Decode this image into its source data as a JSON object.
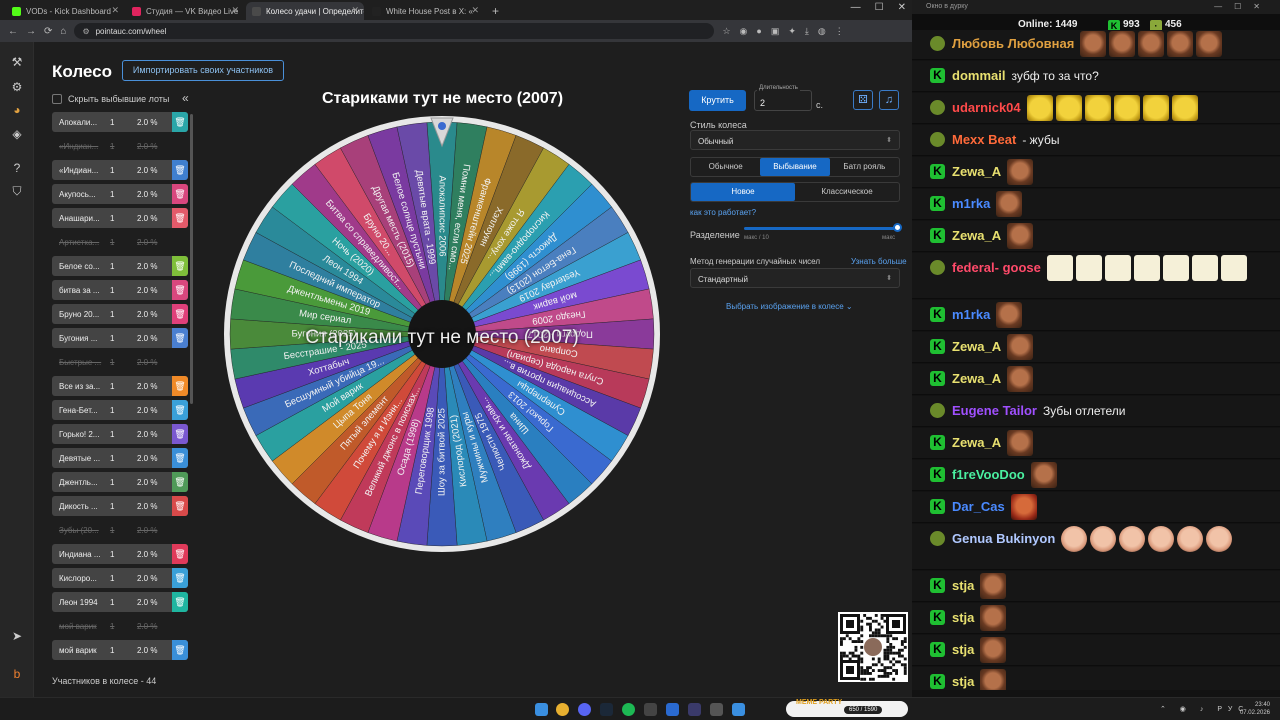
{
  "browser": {
    "tabs": [
      {
        "label": "VODs - Kick Dashboard",
        "color": "#53fc18",
        "active": false
      },
      {
        "label": "Студия — VK Видео Live",
        "color": "#e0245e",
        "active": false
      },
      {
        "label": "Колесо удачи | Определите ви",
        "color": "#4a4a4a",
        "active": true
      },
      {
        "label": "White House Post в X: «",
        "color": "#222222",
        "active": false
      }
    ],
    "url": "pointauc.com/wheel"
  },
  "page": {
    "title": "Колесо",
    "import_button": "Импортировать своих участников",
    "hide_dropped": "Скрыть выбывшие лоты",
    "participants_count": "Участников в колесе - 44",
    "lots": [
      {
        "name": "Апокали...",
        "qty": "1",
        "pct": "2.0 %",
        "color": "#2aa6a8",
        "out": false
      },
      {
        "name": "«Индиан...",
        "qty": "1",
        "pct": "2.0 %",
        "color": "#666666",
        "out": true
      },
      {
        "name": "«Индиан...",
        "qty": "1",
        "pct": "2.0 %",
        "color": "#3f7fcf",
        "out": false
      },
      {
        "name": "Акупось...",
        "qty": "1",
        "pct": "2.0 %",
        "color": "#d9477e",
        "out": false
      },
      {
        "name": "Анашари...",
        "qty": "1",
        "pct": "2.0 %",
        "color": "#e35a6a",
        "out": false
      },
      {
        "name": "Артистка...",
        "qty": "1",
        "pct": "2.0 %",
        "color": "#666666",
        "out": true
      },
      {
        "name": "Белое со...",
        "qty": "1",
        "pct": "2.0 %",
        "color": "#7fbf3a",
        "out": false
      },
      {
        "name": "битва за ...",
        "qty": "1",
        "pct": "2.0 %",
        "color": "#d9477e",
        "out": false
      },
      {
        "name": "Бруно 20...",
        "qty": "1",
        "pct": "2.0 %",
        "color": "#e0407a",
        "out": false
      },
      {
        "name": "Бугония ...",
        "qty": "1",
        "pct": "2.0 %",
        "color": "#4a7fd0",
        "out": false
      },
      {
        "name": "Быстрые ...",
        "qty": "1",
        "pct": "2.0 %",
        "color": "#666666",
        "out": true
      },
      {
        "name": "Все из за...",
        "qty": "1",
        "pct": "2.0 %",
        "color": "#f08a28",
        "out": false
      },
      {
        "name": "Гена-Бет...",
        "qty": "1",
        "pct": "2.0 %",
        "color": "#3aa0d8",
        "out": false
      },
      {
        "name": "Горько! 2...",
        "qty": "1",
        "pct": "2.0 %",
        "color": "#7a58d0",
        "out": false
      },
      {
        "name": "Девятые ...",
        "qty": "1",
        "pct": "2.0 %",
        "color": "#3a8fd8",
        "out": false
      },
      {
        "name": "Джентль...",
        "qty": "1",
        "pct": "2.0 %",
        "color": "#4f9a58",
        "out": false
      },
      {
        "name": "Дикость ...",
        "qty": "1",
        "pct": "2.0 %",
        "color": "#d84a4a",
        "out": false
      },
      {
        "name": "Зубы (20...",
        "qty": "1",
        "pct": "2.0 %",
        "color": "#666666",
        "out": true
      },
      {
        "name": "Индиана ...",
        "qty": "1",
        "pct": "2.0 %",
        "color": "#e03a5a",
        "out": false
      },
      {
        "name": "Кислоро...",
        "qty": "1",
        "pct": "2.0 %",
        "color": "#3aa0d8",
        "out": false
      },
      {
        "name": "Леон 1994",
        "qty": "1",
        "pct": "2.0 %",
        "color": "#1fb6a0",
        "out": false
      },
      {
        "name": "мой варик",
        "qty": "1",
        "pct": "2.0 %",
        "color": "#666666",
        "out": true
      },
      {
        "name": "мой варик",
        "qty": "1",
        "pct": "2.0 %",
        "color": "#3a8fd8",
        "out": false
      }
    ]
  },
  "wheel": {
    "title": "Стариками тут не место (2007)",
    "center_label": "Стариками тут не место (2007)",
    "sectors": [
      {
        "label": "Апокалипсис 2006",
        "color": "#2a8a8c"
      },
      {
        "label": "Помни меня, если смо...",
        "color": "#2f7f5f"
      },
      {
        "label": "Франкенштейн 2025",
        "color": "#b8862a"
      },
      {
        "label": "Хэллоуин",
        "color": "#8a6a2a"
      },
      {
        "label": "Я тоже хочу...",
        "color": "#a89a30"
      },
      {
        "label": "Кислородно-вамп...",
        "color": "#2b9fb0"
      },
      {
        "label": "Дикость (1998)",
        "color": "#2f8fd0"
      },
      {
        "label": "Гена-Бетон (2013)",
        "color": "#4a7fbf"
      },
      {
        "label": "Yesterday 2019",
        "color": "#3aa0d0"
      },
      {
        "label": "мой варик",
        "color": "#7a4ad0"
      },
      {
        "label": "Гнездо 2009",
        "color": "#c04a8a"
      },
      {
        "label": "Подруги - 2017",
        "color": "#8a3a9a"
      },
      {
        "label": "Сопрано",
        "color": "#c04a50"
      },
      {
        "label": "Слуга народа (сериал)",
        "color": "#b83a5a"
      },
      {
        "label": "Ассоциация против в...",
        "color": "#5a3aa8"
      },
      {
        "label": "Суперперцы",
        "color": "#2f8fd0"
      },
      {
        "label": "Горько! 2013",
        "color": "#3a6ad0"
      },
      {
        "label": "Шина",
        "color": "#2a7fc0"
      },
      {
        "label": "Джонатан и храм...",
        "color": "#6a3ab0"
      },
      {
        "label": "Челюсти 1975",
        "color": "#3a5ab8"
      },
      {
        "label": "Мужчины и куры",
        "color": "#2f7fbf"
      },
      {
        "label": "Кислород (2021)",
        "color": "#2a8ab8"
      },
      {
        "label": "Шоу за битвой 2025",
        "color": "#3a5ab8"
      },
      {
        "label": "Переговорщик 1998",
        "color": "#5a4ab8"
      },
      {
        "label": "Осада (1998)",
        "color": "#b83a8a"
      },
      {
        "label": "Великий джонс в поисках...",
        "color": "#c03a5a"
      },
      {
        "label": "Почему я и Иэнн...",
        "color": "#d04a3a"
      },
      {
        "label": "Пятый элемент",
        "color": "#c05a2a"
      },
      {
        "label": "Цыпа Тоня",
        "color": "#d08a2a"
      },
      {
        "label": "Мой варик",
        "color": "#2aa0a0"
      },
      {
        "label": "Бесшумный убийца 19...",
        "color": "#3a6ab8"
      },
      {
        "label": "Хоттабыч",
        "color": "#5a3ab0"
      },
      {
        "label": "Бесстрашие - 2025",
        "color": "#2f8a6a"
      },
      {
        "label": "Бугония (2025)",
        "color": "#4a8a3a"
      },
      {
        "label": "Мир сериал",
        "color": "#3a8a4a"
      },
      {
        "label": "Джентльмены 2019",
        "color": "#4a9a3a"
      },
      {
        "label": "Последний император",
        "color": "#2f7f9f"
      },
      {
        "label": "Леон 1994",
        "color": "#2a8a9a"
      },
      {
        "label": "Ночь (2020)",
        "color": "#2aa0a0"
      },
      {
        "label": "Битва со справедливост...",
        "color": "#a03a8a"
      },
      {
        "label": "Бруно 20...",
        "color": "#d04a6a"
      },
      {
        "label": "Другая месть (2015)",
        "color": "#a8407a"
      },
      {
        "label": "Белое солнце пустыни",
        "color": "#7a3aa0"
      },
      {
        "label": "Девятые врата - 1999",
        "color": "#6a4aa8"
      }
    ]
  },
  "settings": {
    "spin_button": "Крутить",
    "duration_label": "Длительность",
    "duration_value": "2",
    "seconds": "с.",
    "style_label": "Стиль колеса",
    "style_value": "Обычный",
    "modes": [
      "Обычное",
      "Выбывание",
      "Батл рояль"
    ],
    "active_mode": "Выбывание",
    "variants": [
      "Новое",
      "Классическое"
    ],
    "active_variant": "Новое",
    "how_it_works": "как это работает?",
    "split_label": "Разделение",
    "split_min": "макс / 10",
    "split_max": "макс",
    "split_level": 1.0,
    "rng_label": "Метод генерации случайных чисел",
    "learn_more": "Узнать больше",
    "rng_value": "Стандартный",
    "choose_image": "Выбрать изображение в колесе"
  },
  "chat": {
    "window_title": "Окно в дурку",
    "online_label": "Online:",
    "online_value": "1449",
    "kick_value": "993",
    "other_value": "456",
    "messages": [
      {
        "user": "Любовь Любовная",
        "color": "#e0a040",
        "badge": "pepe",
        "text": "",
        "emotes": [
          "face",
          "face",
          "face",
          "face",
          "face"
        ]
      },
      {
        "user": "dommail",
        "color": "#e8e070",
        "badge": "kick",
        "text": "зубф то за что?",
        "emotes": []
      },
      {
        "user": "udarnick04",
        "color": "#ff4a4a",
        "badge": "pepe",
        "text": "",
        "emotes": [
          "lol",
          "lol",
          "lol",
          "lol",
          "lol",
          "lol"
        ]
      },
      {
        "user": "Mexx Beat",
        "color": "#ff6a3a",
        "badge": "pepe",
        "text": "- жубы",
        "emotes": []
      },
      {
        "user": "Zewa_A",
        "color": "#e8e070",
        "badge": "kick",
        "text": "",
        "emotes": [
          "face"
        ]
      },
      {
        "user": "m1rka",
        "color": "#4a8aff",
        "badge": "kick",
        "text": "",
        "emotes": [
          "face"
        ]
      },
      {
        "user": "Zewa_A",
        "color": "#e8e070",
        "badge": "kick",
        "text": "",
        "emotes": [
          "face"
        ]
      },
      {
        "user": "federal- goose",
        "color": "#ff4a6a",
        "badge": "pepe",
        "text": "",
        "emotes": [
          "white",
          "white",
          "white",
          "white",
          "white",
          "white",
          "white"
        ]
      },
      {
        "user": "m1rka",
        "color": "#4a8aff",
        "badge": "kick",
        "text": "",
        "emotes": [
          "face"
        ]
      },
      {
        "user": "Zewa_A",
        "color": "#e8e070",
        "badge": "kick",
        "text": "",
        "emotes": [
          "face"
        ]
      },
      {
        "user": "Zewa_A",
        "color": "#e8e070",
        "badge": "kick",
        "text": "",
        "emotes": [
          "face"
        ]
      },
      {
        "user": "Eugene Tailor",
        "color": "#a050ff",
        "badge": "pepe",
        "text": "Зубы отлетели",
        "emotes": []
      },
      {
        "user": "Zewa_A",
        "color": "#e8e070",
        "badge": "kick",
        "text": "",
        "emotes": [
          "face"
        ]
      },
      {
        "user": "f1reVooDoo",
        "color": "#4af0a0",
        "badge": "kick",
        "text": "",
        "emotes": [
          "face"
        ]
      },
      {
        "user": "Dar_Cas",
        "color": "#4a8aff",
        "badge": "kick",
        "text": "",
        "emotes": [
          "red"
        ]
      },
      {
        "user": "Genua Bukinyon",
        "color": "#b0c8ff",
        "badge": "pepe",
        "text": "",
        "emotes": [
          "girl",
          "girl",
          "girl",
          "girl",
          "girl",
          "girl"
        ]
      },
      {
        "user": "stja",
        "color": "#e8e070",
        "badge": "kick",
        "text": "",
        "emotes": [
          "face"
        ]
      },
      {
        "user": "stja",
        "color": "#e8e070",
        "badge": "kick",
        "text": "",
        "emotes": [
          "face"
        ]
      },
      {
        "user": "stja",
        "color": "#e8e070",
        "badge": "kick",
        "text": "",
        "emotes": [
          "face"
        ]
      },
      {
        "user": "stja",
        "color": "#e8e070",
        "badge": "kick",
        "text": "",
        "emotes": [
          "face"
        ]
      }
    ]
  },
  "taskbar": {
    "meter_label": "650 / 1590",
    "meter_title": "MEME PARTY",
    "lang": "РУС",
    "time": "23:40",
    "date": "07.02.2026"
  }
}
